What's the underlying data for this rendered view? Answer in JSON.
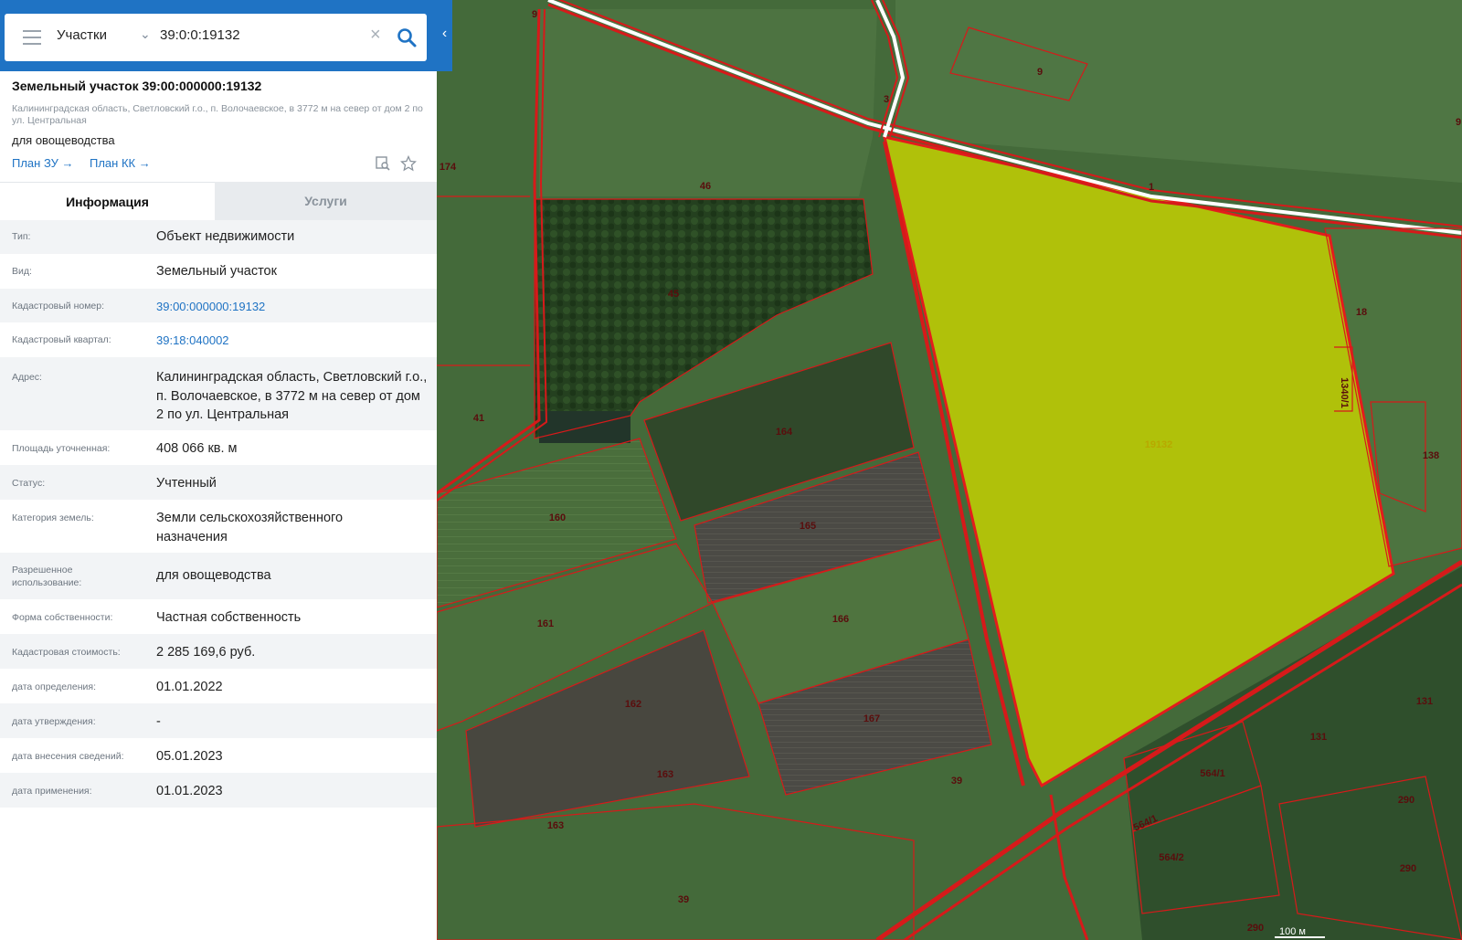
{
  "search": {
    "layer": "Участки",
    "query": "39:0:0:19132"
  },
  "parcel": {
    "title": "Земельный участок 39:00:000000:19132",
    "address_short": "Калининградская область, Светловский г.о., п. Волочаевское, в 3772 м на север от дом 2 по ул. Центральная",
    "purpose": "для овощеводства",
    "link_plan_zu": "План ЗУ →",
    "link_plan_kk": "План КК →"
  },
  "tabs": [
    {
      "label": "Информация",
      "active": true
    },
    {
      "label": "Услуги",
      "active": false
    }
  ],
  "info": [
    {
      "key": "Тип:",
      "value": "Объект недвижимости"
    },
    {
      "key": "Вид:",
      "value": "Земельный участок"
    },
    {
      "key": "Кадастровый номер:",
      "value": "39:00:000000:19132",
      "link": true
    },
    {
      "key": "Кадастровый квартал:",
      "value": "39:18:040002",
      "link": true
    },
    {
      "key": "Адрес:",
      "value": "Калининградская область, Светловский г.о., п. Волочаевское, в 3772 м на север от дом 2 по ул. Центральная"
    },
    {
      "key": "Площадь уточненная:",
      "value": "408 066 кв. м"
    },
    {
      "key": "Статус:",
      "value": "Учтенный"
    },
    {
      "key": "Категория земель:",
      "value": "Земли сельскохозяйственного назначения"
    },
    {
      "key": "Разрешенное использование:",
      "value": "для овощеводства"
    },
    {
      "key": "Форма собственности:",
      "value": "Частная собственность"
    },
    {
      "key": "Кадастровая стоимость:",
      "value": "2 285 169,6 руб."
    },
    {
      "key": "дата определения:",
      "value": "01.01.2022"
    },
    {
      "key": "дата утверждения:",
      "value": "-"
    },
    {
      "key": "дата внесения сведений:",
      "value": "05.01.2023"
    },
    {
      "key": "дата применения:",
      "value": "01.01.2023"
    }
  ],
  "map": {
    "selected_label": "19132",
    "scale": "100 м",
    "highlight_color": "#c8d400",
    "boundary_color": "#d61a1a",
    "labels": [
      "9",
      "9",
      "3",
      "1",
      "174",
      "46",
      "45",
      "41",
      "164",
      "165",
      "160",
      "161",
      "166",
      "162",
      "167",
      "163",
      "163",
      "39",
      "39",
      "18",
      "1340/1",
      "138",
      "131",
      "131",
      "564/1",
      "564/1",
      "564/2",
      "290",
      "290",
      "290",
      "9"
    ]
  }
}
